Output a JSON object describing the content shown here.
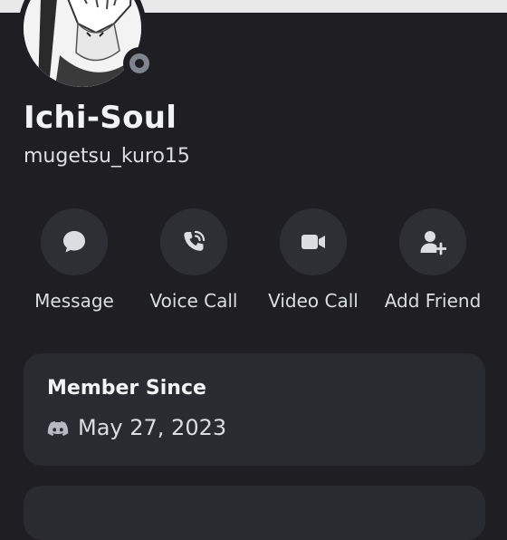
{
  "profile": {
    "display_name": "Ichi-Soul",
    "username": "mugetsu_kuro15",
    "status": "offline"
  },
  "actions": [
    {
      "label": "Message",
      "icon": "chat-bubble-icon"
    },
    {
      "label": "Voice Call",
      "icon": "phone-call-icon"
    },
    {
      "label": "Video Call",
      "icon": "video-camera-icon"
    },
    {
      "label": "Add Friend",
      "icon": "add-friend-icon"
    }
  ],
  "member_since": {
    "title": "Member Since",
    "icon": "discord-logo-icon",
    "date": "May 27, 2023"
  },
  "colors": {
    "background": "#1f1f23",
    "card": "#2a2b30",
    "action_circle": "#2e2f35",
    "status_offline": "#80848e"
  }
}
